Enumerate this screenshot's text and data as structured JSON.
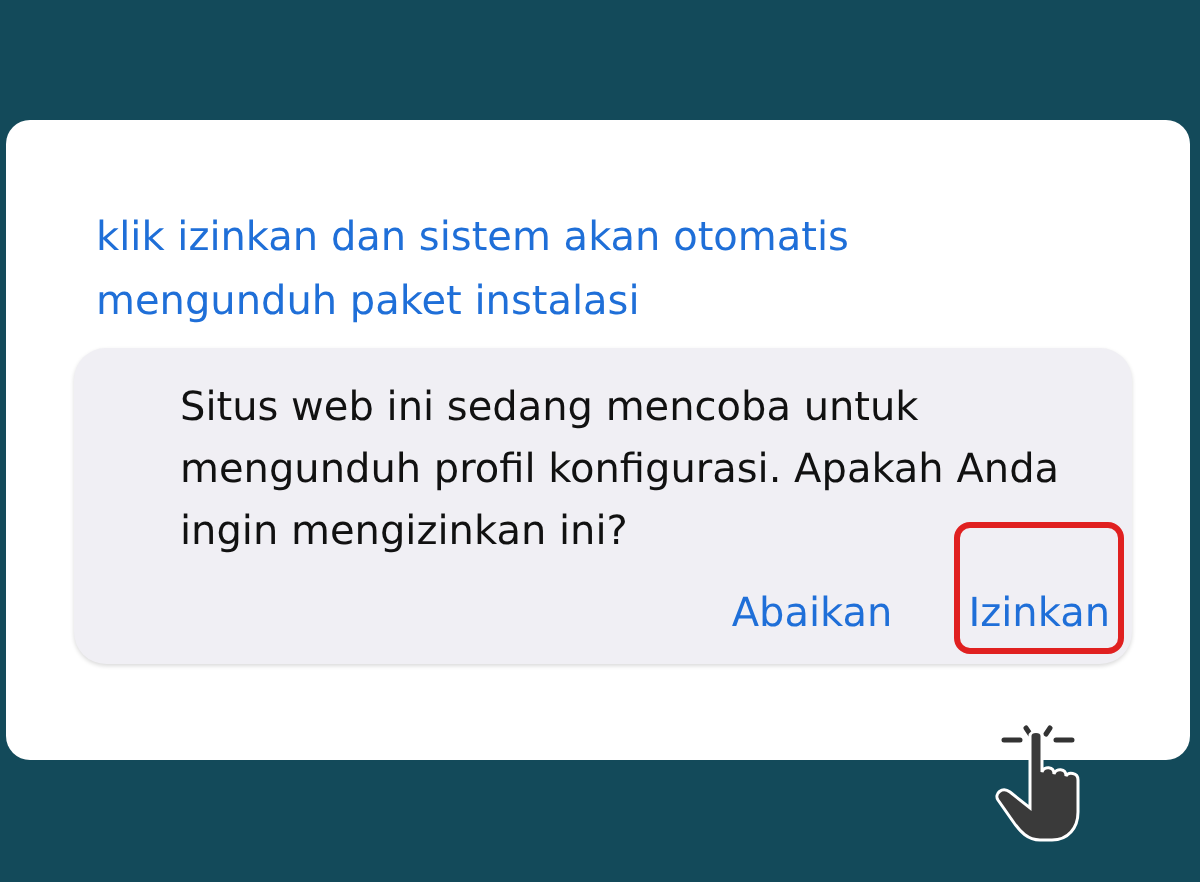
{
  "instruction": "klik izinkan dan sistem akan otomatis mengunduh paket instalasi",
  "dialog": {
    "message": "Situs web ini sedang mencoba untuk mengunduh profil konfigurasi. Apakah Anda ingin mengizinkan ini?",
    "buttons": [
      {
        "label": "Abaikan",
        "highlighted": false
      },
      {
        "label": "Izinkan",
        "highlighted": true
      }
    ]
  }
}
